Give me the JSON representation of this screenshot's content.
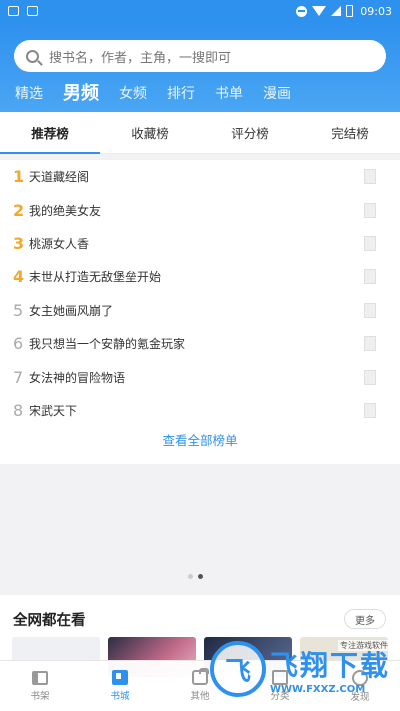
{
  "status_bar": {
    "time": "09:03",
    "icons": [
      "image-icon",
      "app-icon",
      "dnd-icon",
      "wifi-icon",
      "signal-icon",
      "battery-icon"
    ]
  },
  "search": {
    "placeholder": "搜书名，作者，主角，一搜即可"
  },
  "channels": [
    {
      "label": "精选",
      "active": false
    },
    {
      "label": "男频",
      "active": true
    },
    {
      "label": "女频",
      "active": false
    },
    {
      "label": "排行",
      "active": false
    },
    {
      "label": "书单",
      "active": false
    },
    {
      "label": "漫画",
      "active": false
    }
  ],
  "rank_tabs": [
    {
      "label": "推荐榜",
      "active": true
    },
    {
      "label": "收藏榜",
      "active": false
    },
    {
      "label": "评分榜",
      "active": false
    },
    {
      "label": "完结榜",
      "active": false
    }
  ],
  "rank_list": [
    {
      "num": "1",
      "title": "天道藏经阁"
    },
    {
      "num": "2",
      "title": "我的绝美女友"
    },
    {
      "num": "3",
      "title": "桃源女人香"
    },
    {
      "num": "4",
      "title": "末世从打造无敌堡垒开始"
    },
    {
      "num": "5",
      "title": "女主她画风崩了"
    },
    {
      "num": "6",
      "title": "我只想当一个安静的氪金玩家"
    },
    {
      "num": "7",
      "title": "女法神的冒险物语"
    },
    {
      "num": "8",
      "title": "宋武天下"
    }
  ],
  "view_all": "查看全部榜单",
  "section": {
    "title": "全网都在看",
    "more": "更多"
  },
  "bottom_nav": [
    {
      "label": "书架",
      "icon": "bookshelf-icon",
      "active": false
    },
    {
      "label": "书城",
      "icon": "bookstore-icon",
      "active": true
    },
    {
      "label": "其他",
      "icon": "other-icon",
      "active": false
    },
    {
      "label": "分类",
      "icon": "category-icon",
      "active": false
    },
    {
      "label": "发现",
      "icon": "discover-icon",
      "active": false
    }
  ],
  "watermark": {
    "main": "飞翔下载",
    "sub": "WWW.FXXZ.COM",
    "tag": "专注游戏软件"
  },
  "colors": {
    "primary": "#2f91ee",
    "rank_top": "#f4a82a",
    "rank_other": "#aaaaaa"
  }
}
